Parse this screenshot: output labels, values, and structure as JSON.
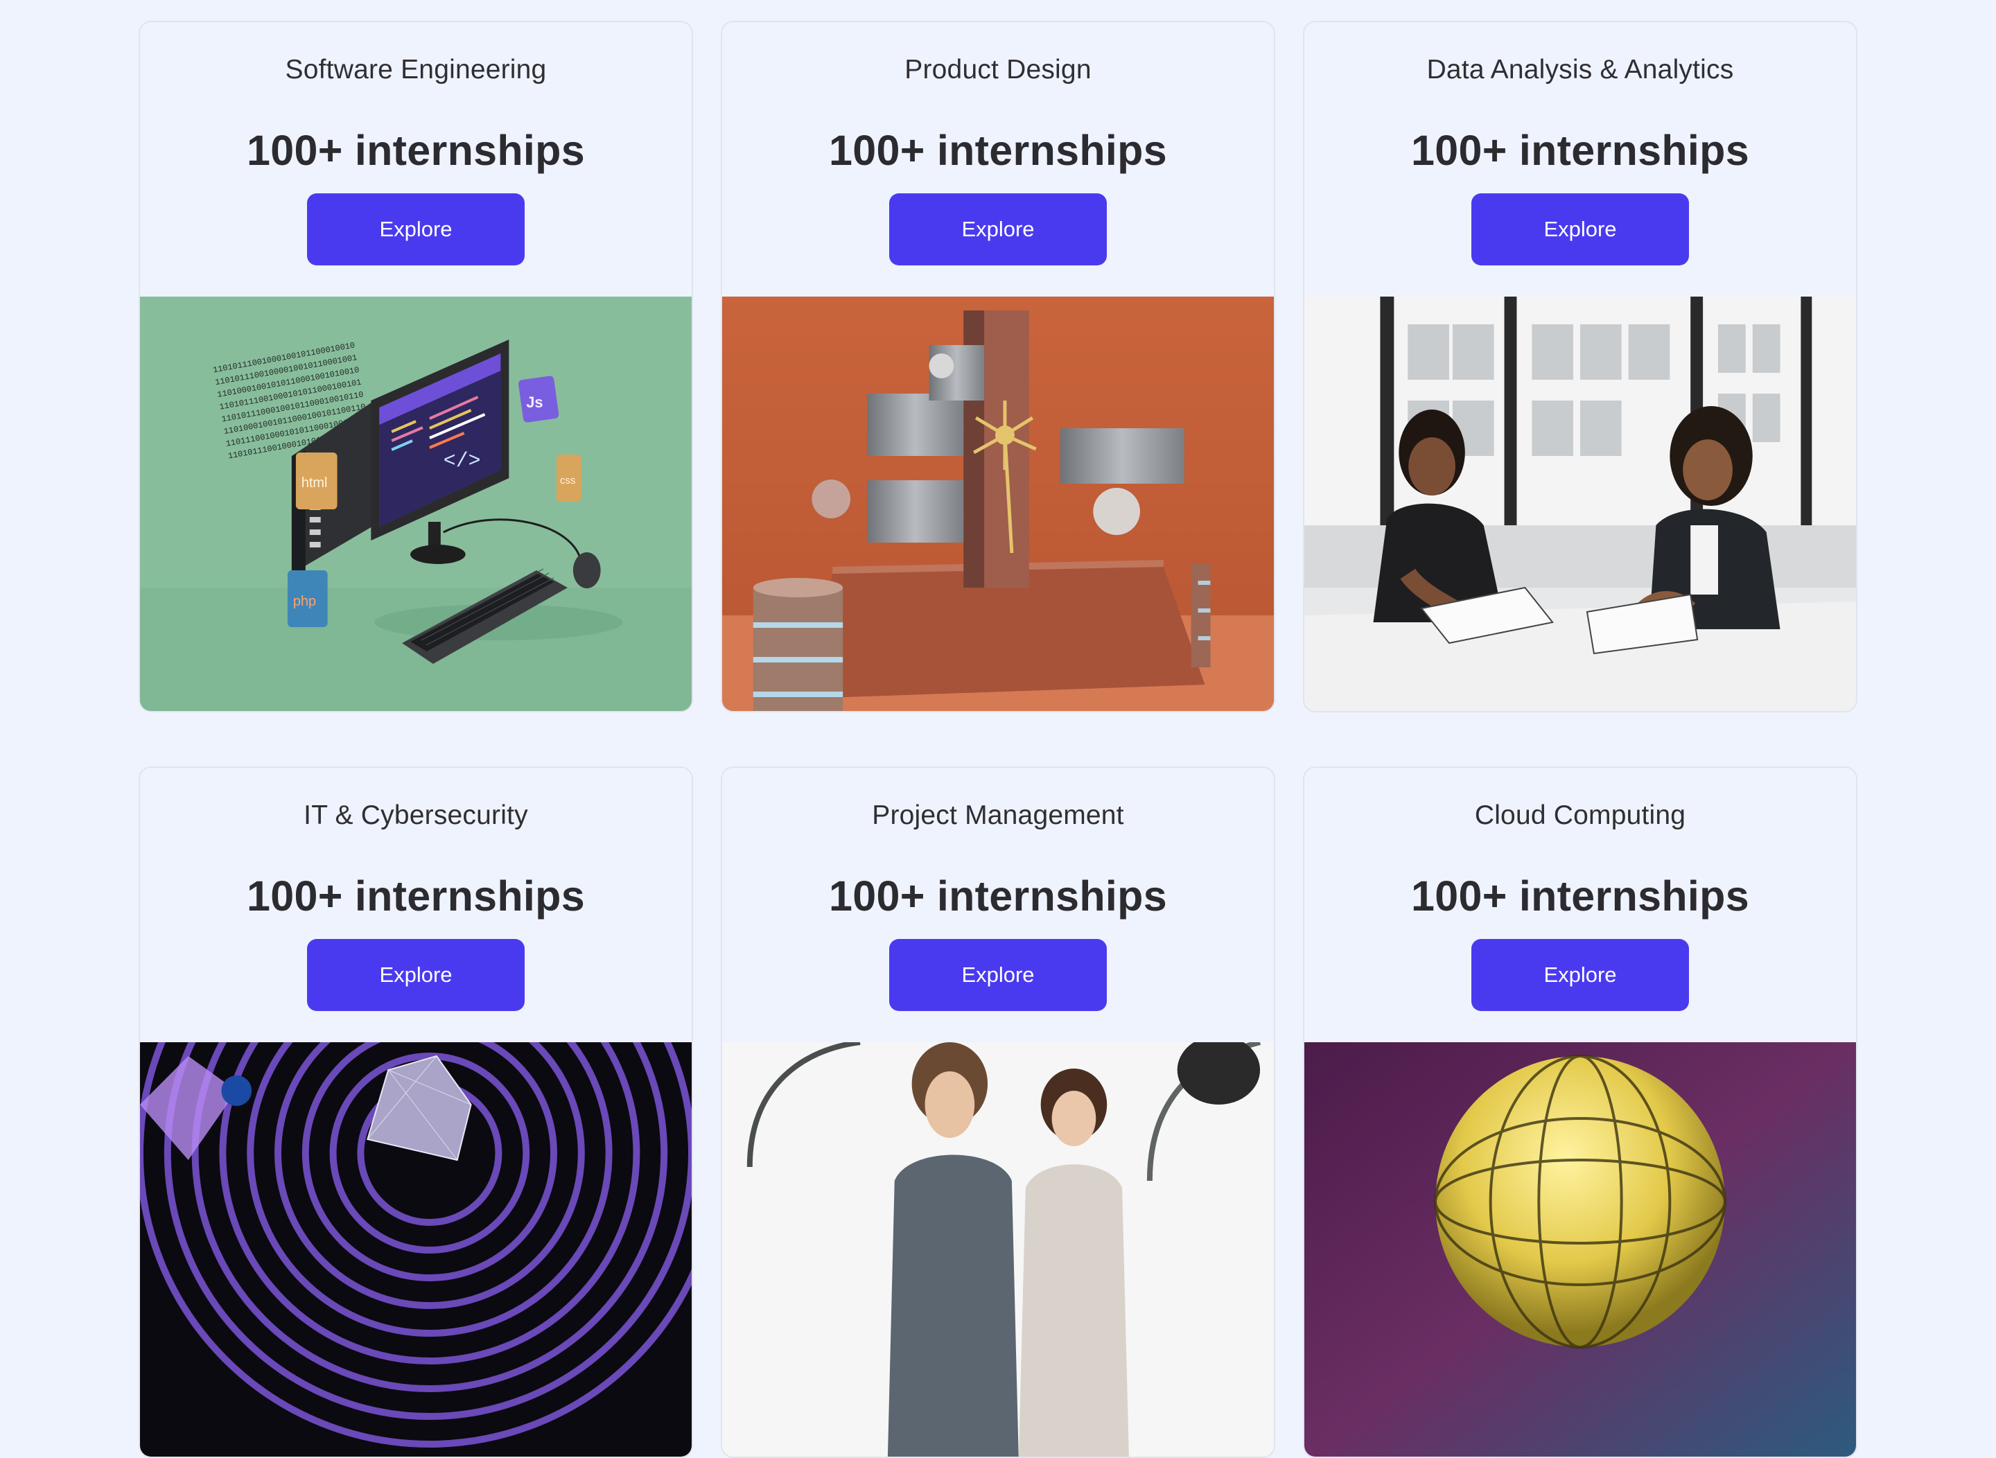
{
  "cards": [
    {
      "category": "Software Engineering",
      "count": "100+ internships",
      "button_label": "Explore",
      "image_labels": {
        "html": "html",
        "js": "Js",
        "css": "css",
        "php": "php",
        "code": "</>",
        "binary_1": "11010111001000100101100010010",
        "binary_2": "11010111001000010010110001001",
        "binary_3": "11010001001010110001001010010",
        "binary_4": "11010111001000101011000100101",
        "binary_5": "11010111000100101100010010110",
        "binary_6": "11010001001011000100101100110",
        "binary_7": "11011100100010101100010010110",
        "binary_8": "11010111001000101011000100101"
      }
    },
    {
      "category": "Product Design",
      "count": "100+ internships",
      "button_label": "Explore"
    },
    {
      "category": "Data Analysis & Analytics",
      "count": "100+ internships",
      "button_label": "Explore"
    },
    {
      "category": "IT & Cybersecurity",
      "count": "100+ internships",
      "button_label": "Explore"
    },
    {
      "category": "Project Management",
      "count": "100+ internships",
      "button_label": "Explore"
    },
    {
      "category": "Cloud Computing",
      "count": "100+ internships",
      "button_label": "Explore"
    }
  ],
  "colors": {
    "page_background": "#eff3fd",
    "button_background": "#4a3aef",
    "button_text": "#ffffff",
    "text": "#2b2b30"
  }
}
